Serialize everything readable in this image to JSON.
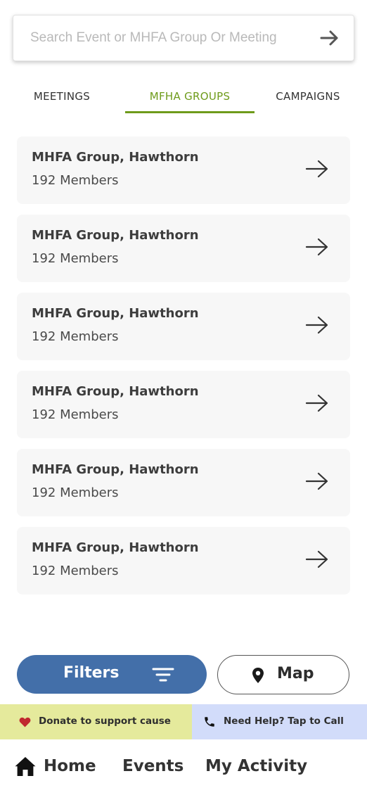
{
  "search": {
    "placeholder": "Search Event or MHFA Group Or Meeting",
    "icon": "arrow-right-icon"
  },
  "tabs": [
    {
      "label": "MEETINGS",
      "active": false
    },
    {
      "label": "MFHA GROUPS",
      "active": true
    },
    {
      "label": "CAMPAIGNS",
      "active": false
    }
  ],
  "groups": [
    {
      "name": "MHFA Group, Hawthorn",
      "members": "192 Members"
    },
    {
      "name": "MHFA Group, Hawthorn",
      "members": "192 Members"
    },
    {
      "name": "MHFA Group, Hawthorn",
      "members": "192 Members"
    },
    {
      "name": "MHFA Group, Hawthorn",
      "members": "192 Members"
    },
    {
      "name": "MHFA Group, Hawthorn",
      "members": "192 Members"
    },
    {
      "name": "MHFA Group, Hawthorn",
      "members": "192 Members"
    }
  ],
  "actions": {
    "filters_label": "Filters",
    "map_label": "Map"
  },
  "support": {
    "donate_label": "Donate to support cause",
    "help_label": "Need Help? Tap to Call"
  },
  "nav": {
    "home": "Home",
    "events": "Events",
    "activity": "My Activity"
  },
  "colors": {
    "accent_green": "#6e9b1b",
    "filters_blue": "#436fa9",
    "donate_bg": "#e5ea9c",
    "help_bg": "#d2dcfa",
    "heart_red": "#c0292f",
    "card_bg": "#f7f7f7"
  }
}
